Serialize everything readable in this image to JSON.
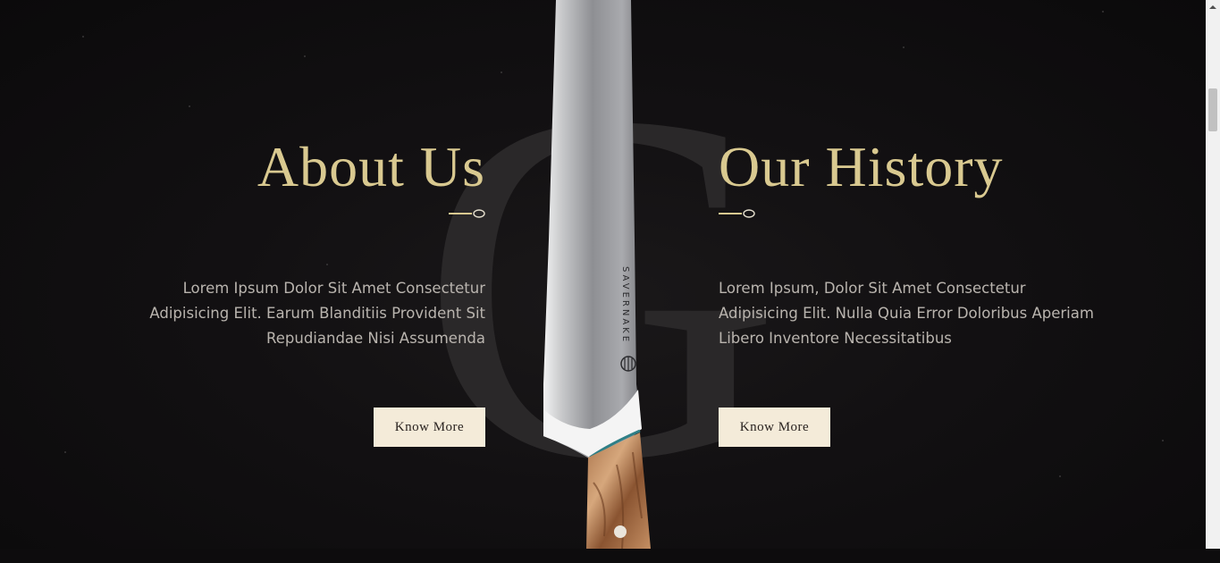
{
  "background": {
    "letter": "G"
  },
  "knife": {
    "brand": "SAVERNAKE"
  },
  "about": {
    "title": "About Us",
    "text": "Lorem Ipsum Dolor Sit Amet Consectetur Adipisicing Elit. Earum Blanditiis Provident Sit Repudiandae Nisi Assumenda",
    "button_label": "Know More"
  },
  "history": {
    "title": "Our History",
    "text": "Lorem Ipsum, Dolor Sit Amet Consectetur Adipisicing Elit. Nulla Quia Error Doloribus Aperiam Libero Inventore Necessitatibus",
    "button_label": "Know More"
  },
  "colors": {
    "background": "#0d0c0d",
    "title_gold": "#d9c990",
    "button_bg": "#f4ebd9",
    "body_text": "#b9b4ae"
  }
}
